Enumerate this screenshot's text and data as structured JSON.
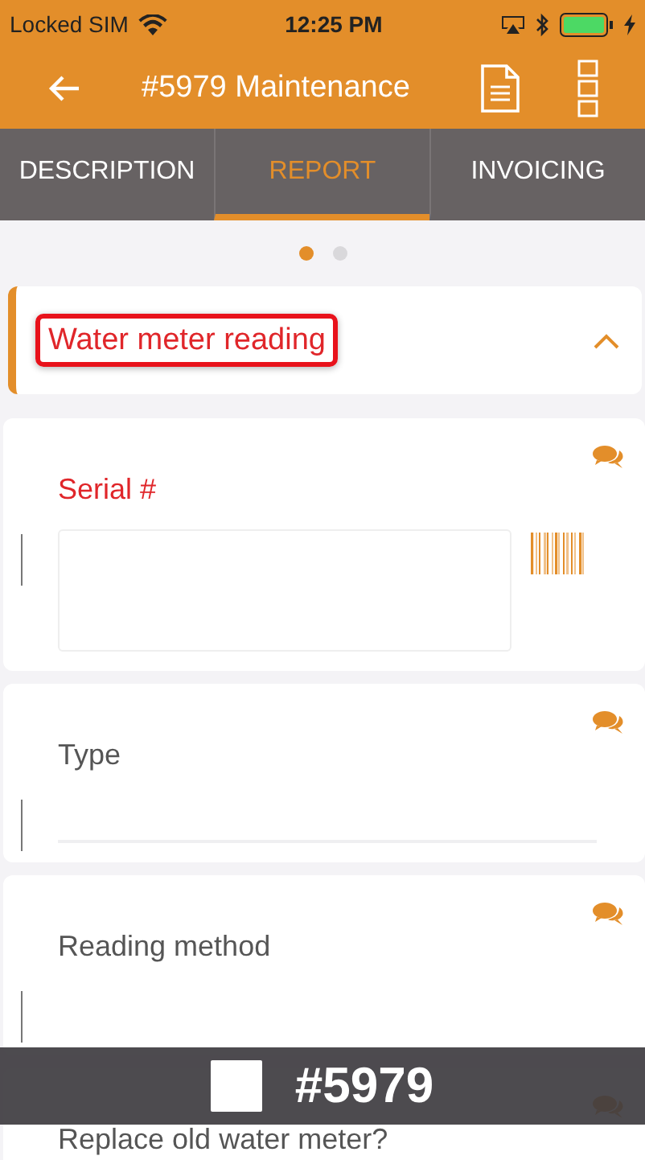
{
  "status_bar": {
    "carrier": "Locked SIM",
    "time": "12:25 PM"
  },
  "app_bar": {
    "title": "#5979 Maintenance"
  },
  "tabs": [
    {
      "label": "DESCRIPTION",
      "selected": false
    },
    {
      "label": "REPORT",
      "selected": true
    },
    {
      "label": "INVOICING",
      "selected": false
    }
  ],
  "pager": [
    {
      "selected": true
    },
    {
      "selected": false
    }
  ],
  "section": {
    "title": "Water meter reading",
    "expanded": true,
    "highlighted": true
  },
  "fields": [
    {
      "kind": "scan",
      "label": "Serial #",
      "error": true
    },
    {
      "kind": "select",
      "label": "Type",
      "error": false
    },
    {
      "kind": "plain",
      "label": "Reading method",
      "error": false
    },
    {
      "kind": "plain",
      "label": "Replace old water meter?",
      "error": false
    }
  ],
  "overlay": {
    "label": "#5979"
  }
}
